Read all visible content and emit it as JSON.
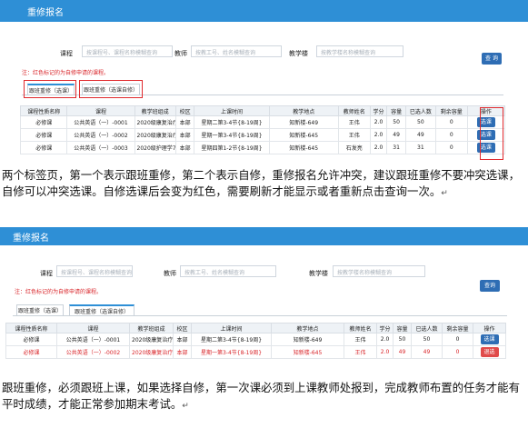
{
  "shot1": {
    "title": "重修报名",
    "search": {
      "course_label": "课程",
      "course_placeholder": "按课程号、课程名称模糊查询",
      "teacher_label": "教师",
      "teacher_placeholder": "按教工号、姓名模糊查询",
      "place_label": "教学楼",
      "place_placeholder": "按教学楼名称模糊查询",
      "query_button": "查 询"
    },
    "note": "注：红色标记的为自修申请的课程。",
    "tabs": [
      "跟班重修（选课）",
      "跟班重修（选课自修）"
    ],
    "columns": [
      "课程性质名称",
      "课程",
      "教学班组成",
      "校区",
      "上课时间",
      "教学地点",
      "教师姓名",
      "学分",
      "容量",
      "已选人数",
      "剩余容量",
      "操作"
    ],
    "rows": [
      [
        "必修课",
        "公共英语（一）-0001",
        "2020级康复治疗",
        "本部",
        "星期二第3-4节{8-19周}",
        "知新楼-649",
        "王伟",
        "2.0",
        "50",
        "50",
        "0",
        "选课"
      ],
      [
        "必修课",
        "公共英语（一）-0002",
        "2020级康复治疗",
        "本部",
        "星期一第3-4节{8-19周}",
        "知新楼-645",
        "王伟",
        "2.0",
        "49",
        "49",
        "0",
        "选课"
      ],
      [
        "必修课",
        "公共英语（一）-0003",
        "2020级护理学7",
        "本部",
        "星期四第1-2节{8-19周}",
        "知新楼-645",
        "石发亮",
        "2.0",
        "31",
        "31",
        "0",
        "选课"
      ]
    ]
  },
  "para1": "两个标签页，第一个表示跟班重修，第二个表示自修，重修报名允许冲突，建议跟班重修不要冲突选课，自修可以冲突选课。自修选课后会变为红色，需要刷新才能显示或者重新点击查询一次。",
  "shot2": {
    "title": "重修报名",
    "search": {
      "course_label": "课程",
      "course_placeholder": "按课程号、课程名称模糊查询",
      "teacher_label": "教师",
      "teacher_placeholder": "按教工号、姓名模糊查询",
      "place_label": "教学楼",
      "place_placeholder": "按教学楼名称模糊查询",
      "query_button": "查询"
    },
    "note": "注：红色标记的为自修申请的课程。",
    "tabs": [
      "跟班重修（选课）",
      "跟班重修（选课自修）"
    ],
    "columns": [
      "课程性质名称",
      "课程",
      "教学班组成",
      "校区",
      "上课时间",
      "教学地点",
      "教师姓名",
      "学分",
      "容量",
      "已选人数",
      "剩余容量",
      "操作"
    ],
    "rows": [
      [
        "必修课",
        "公共英语（一）-0001",
        "2020级康复治疗",
        "本部",
        "星期二第3-4节{8-19周}",
        "知新楼-649",
        "王伟",
        "2.0",
        "50",
        "50",
        "0",
        "选课"
      ],
      [
        "必修课",
        "公共英语（一）-0002",
        "2020级康复治疗",
        "本部",
        "星期一第3-4节{8-19周}",
        "知新楼-645",
        "王伟",
        "2.0",
        "49",
        "49",
        "0",
        "退选"
      ]
    ]
  },
  "para2": "跟班重修，必须跟班上课，如果选择自修，第一次课必须到上课教师处报到，完成教师布置的任务才能有平时成绩，才能正常参加期末考试。"
}
